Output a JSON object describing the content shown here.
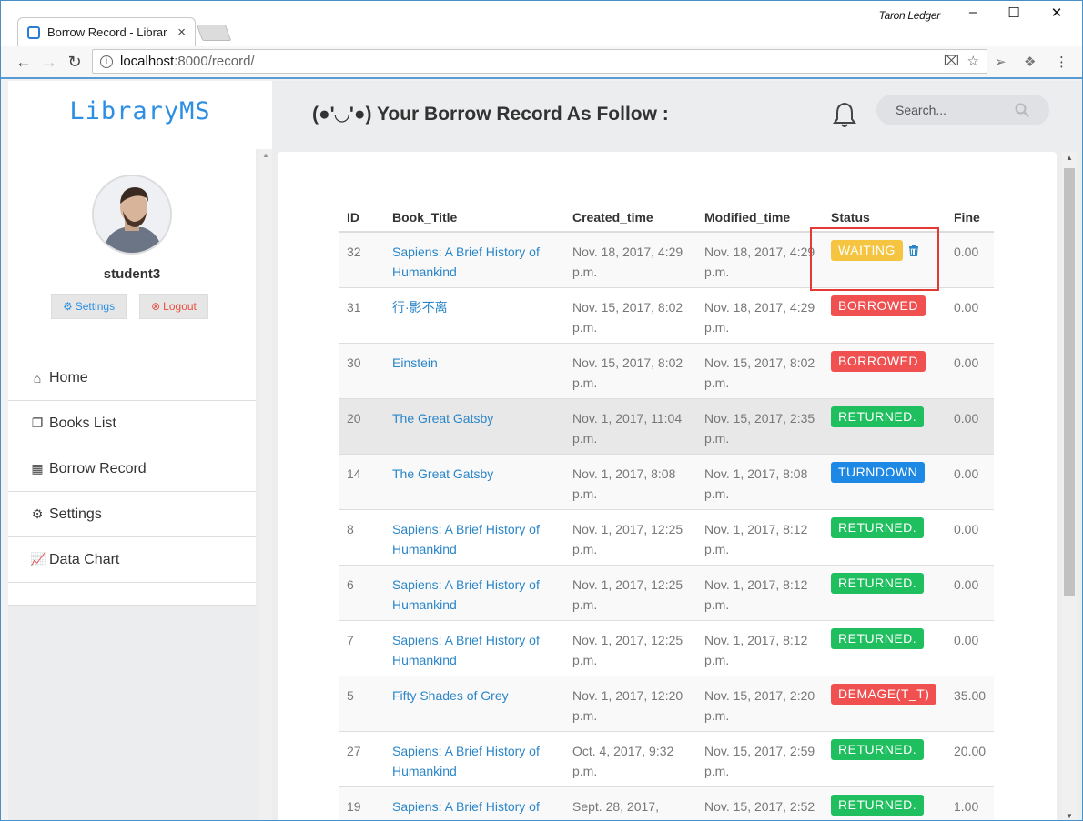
{
  "browser": {
    "tab_title": "Borrow Record - Librar",
    "tab_close": "×",
    "profile_name": "Taron Ledger",
    "url_host": "localhost",
    "url_rest": ":8000/record/",
    "window_controls": [
      "–",
      "☐",
      "✕"
    ]
  },
  "sidebar": {
    "brand": "LibraryMS",
    "username": "student3",
    "settings_label": "Settings",
    "logout_label": "Logout",
    "nav": [
      {
        "label": "Home",
        "icon": "home-icon"
      },
      {
        "label": "Books List",
        "icon": "copy-icon"
      },
      {
        "label": "Borrow Record",
        "icon": "table-icon"
      },
      {
        "label": "Settings",
        "icon": "gear-icon"
      },
      {
        "label": "Data Chart",
        "icon": "line-chart-icon"
      }
    ]
  },
  "header": {
    "title": "(●'◡'●) Your Borrow Record As Follow :",
    "search_placeholder": "Search..."
  },
  "table": {
    "columns": [
      "ID",
      "Book_Title",
      "Created_time",
      "Modified_time",
      "Status",
      "Fine"
    ],
    "rows": [
      {
        "id": "32",
        "title": "Sapiens: A Brief History of Humankind",
        "created": "Nov. 18, 2017, 4:29 p.m.",
        "modified": "Nov. 18, 2017, 4:29 p.m.",
        "status": "WAITING",
        "fine": "0.00"
      },
      {
        "id": "31",
        "title": "行·影不离",
        "created": "Nov. 15, 2017, 8:02 p.m.",
        "modified": "Nov. 18, 2017, 4:29 p.m.",
        "status": "BORROWED",
        "fine": "0.00"
      },
      {
        "id": "30",
        "title": "Einstein",
        "created": "Nov. 15, 2017, 8:02 p.m.",
        "modified": "Nov. 15, 2017, 8:02 p.m.",
        "status": "BORROWED",
        "fine": "0.00"
      },
      {
        "id": "20",
        "title": "The Great Gatsby",
        "created": "Nov. 1, 2017, 11:04 p.m.",
        "modified": "Nov. 15, 2017, 2:35 p.m.",
        "status": "RETURNED.",
        "fine": "0.00"
      },
      {
        "id": "14",
        "title": "The Great Gatsby",
        "created": "Nov. 1, 2017, 8:08 p.m.",
        "modified": "Nov. 1, 2017, 8:08 p.m.",
        "status": "TURNDOWN",
        "fine": "0.00"
      },
      {
        "id": "8",
        "title": "Sapiens: A Brief History of Humankind",
        "created": "Nov. 1, 2017, 12:25 p.m.",
        "modified": "Nov. 1, 2017, 8:12 p.m.",
        "status": "RETURNED.",
        "fine": "0.00"
      },
      {
        "id": "6",
        "title": "Sapiens: A Brief History of Humankind",
        "created": "Nov. 1, 2017, 12:25 p.m.",
        "modified": "Nov. 1, 2017, 8:12 p.m.",
        "status": "RETURNED.",
        "fine": "0.00"
      },
      {
        "id": "7",
        "title": "Sapiens: A Brief History of Humankind",
        "created": "Nov. 1, 2017, 12:25 p.m.",
        "modified": "Nov. 1, 2017, 8:12 p.m.",
        "status": "RETURNED.",
        "fine": "0.00"
      },
      {
        "id": "5",
        "title": "Fifty Shades of Grey",
        "created": "Nov. 1, 2017, 12:20 p.m.",
        "modified": "Nov. 15, 2017, 2:20 p.m.",
        "status": "DEMAGE(T_T)",
        "fine": "35.00"
      },
      {
        "id": "27",
        "title": "Sapiens: A Brief History of Humankind",
        "created": "Oct. 4, 2017, 9:32 p.m.",
        "modified": "Nov. 15, 2017, 2:59 p.m.",
        "status": "RETURNED.",
        "fine": "20.00"
      },
      {
        "id": "19",
        "title": "Sapiens: A Brief History of",
        "created": "Sept. 28, 2017,",
        "modified": "Nov. 15, 2017, 2:52",
        "status": "RETURNED.",
        "fine": "1.00"
      }
    ]
  },
  "status_colors": {
    "WAITING": "#f5c542",
    "BORROWED": "#f05050",
    "RETURNED.": "#1fbf5f",
    "TURNDOWN": "#1e88e5",
    "DEMAGE(T_T)": "#f05050"
  },
  "colors": {
    "brand": "#2c8fe4",
    "link": "#2a86c9",
    "highlight_box": "#e53935"
  }
}
